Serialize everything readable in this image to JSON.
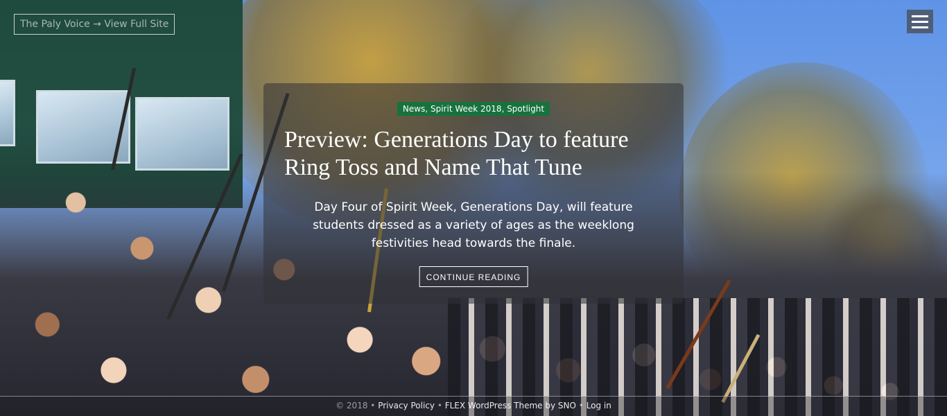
{
  "header": {
    "site_link_label": "The Paly Voice → View Full Site",
    "menu_icon": "hamburger-menu-icon"
  },
  "story": {
    "categories": "News, Spirit Week 2018, Spotlight",
    "headline": "Preview: Generations Day to feature Ring Toss and Name That Tune",
    "teaser": "Day Four of Spirit Week, Generations Day, will feature students dressed as a variety of ages as the weeklong festivities head towards the finale.",
    "continue_label": "CONTINUE READING"
  },
  "footer": {
    "copyright": "© 2018",
    "separator": "•",
    "privacy_label": "Privacy Policy",
    "theme_prefix": "FLEX WordPress Theme by SNO",
    "login_label": "Log in"
  },
  "colors": {
    "category_tag": "#17723d",
    "menu_button": "#4f5e78"
  }
}
